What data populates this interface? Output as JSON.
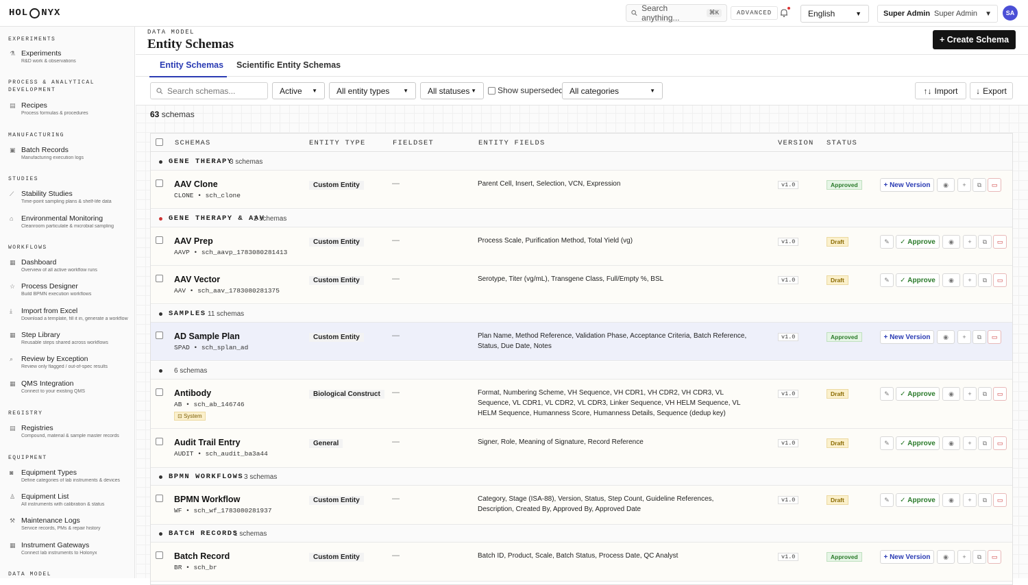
{
  "topbar": {
    "logo_left": "HOL",
    "logo_right": "NYX",
    "search_placeholder": "Search anything...",
    "search_shortcut": "⌘K",
    "advanced_label": "ADVANCED",
    "language": "English",
    "user_role": "Super Admin",
    "user_select": "Super Admin",
    "avatar_initials": "SA"
  },
  "sidebar": {
    "sections": [
      {
        "title": "EXPERIMENTS"
      },
      {
        "title": "PROCESS & ANALYTICAL DEVELOPMENT"
      },
      {
        "title": "MANUFACTURING"
      },
      {
        "title": "STUDIES"
      },
      {
        "title": "WORKFLOWS"
      },
      {
        "title": "REGISTRY"
      },
      {
        "title": "EQUIPMENT"
      },
      {
        "title": "DATA MODEL"
      }
    ],
    "items": [
      {
        "label": "Experiments",
        "desc": "R&D work & observations",
        "icon": "flask-icon"
      },
      {
        "label": "Recipes",
        "desc": "Process formulas & procedures",
        "icon": "document-icon"
      },
      {
        "label": "Batch Records",
        "desc": "Manufacturing execution logs",
        "icon": "clipboard-icon"
      },
      {
        "label": "Stability Studies",
        "desc": "Time-point sampling plans & shelf-life data",
        "icon": "chart-line-icon"
      },
      {
        "label": "Environmental Monitoring",
        "desc": "Cleanroom particulate & microbial sampling",
        "icon": "house-icon"
      },
      {
        "label": "Dashboard",
        "desc": "Overview of all active workflow runs",
        "icon": "grid-icon"
      },
      {
        "label": "Process Designer",
        "desc": "Build BPMN execution workflows",
        "icon": "star-icon"
      },
      {
        "label": "Import from Excel",
        "desc": "Download a template, fill it in, generate a workflow",
        "icon": "download-icon"
      },
      {
        "label": "Step Library",
        "desc": "Reusable steps shared across workflows",
        "icon": "grid-icon"
      },
      {
        "label": "Review by Exception",
        "desc": "Review only flagged / out-of-spec results",
        "icon": "search-icon"
      },
      {
        "label": "QMS Integration",
        "desc": "Connect to your existing QMS",
        "icon": "grid-icon"
      },
      {
        "label": "Registries",
        "desc": "Compound, material & sample master records",
        "icon": "database-icon"
      },
      {
        "label": "Equipment Types",
        "desc": "Define categories of lab instruments & devices",
        "icon": "camera-icon"
      },
      {
        "label": "Equipment List",
        "desc": "All instruments with calibration & status",
        "icon": "person-icon"
      },
      {
        "label": "Maintenance Logs",
        "desc": "Service records, PMs & repair history",
        "icon": "wrench-icon"
      },
      {
        "label": "Instrument Gateways",
        "desc": "Connect lab instruments to Holonyx",
        "icon": "grid-icon"
      }
    ]
  },
  "header": {
    "breadcrumb": "DATA MODEL",
    "title": "Entity Schemas",
    "create_button": "+ Create Schema"
  },
  "tabs": [
    {
      "label": "Entity Schemas",
      "active": true
    },
    {
      "label": "Scientific Entity Schemas",
      "active": false
    }
  ],
  "filters": {
    "search_placeholder": "Search schemas...",
    "state": "Active",
    "entity_types": "All entity types",
    "statuses": "All statuses",
    "show_superseded": "Show superseded",
    "categories": "All categories",
    "import_label": "Import",
    "export_label": "Export"
  },
  "count": {
    "number": "63",
    "label": "schemas"
  },
  "table": {
    "headers": [
      "SCHEMAS",
      "ENTITY TYPE",
      "FIELDSET",
      "ENTITY FIELDS",
      "VERSION",
      "STATUS"
    ],
    "groups": [
      {
        "name": "GENE THERAPY",
        "count": "3 schemas"
      },
      {
        "name": "GENE THERAPY & AAV",
        "count": "2 schemas"
      },
      {
        "name": "SAMPLES",
        "count": "11 schemas"
      },
      {
        "name": "",
        "count": "6 schemas"
      },
      {
        "name": "BPMN WORKFLOWS",
        "count": "3 schemas"
      },
      {
        "name": "BATCH RECORDS",
        "count": "1 schemas"
      }
    ],
    "rows": [
      {
        "name": "AAV Clone",
        "code": "CLONE  •  sch_clone",
        "type": "Custom Entity",
        "fieldset": "—",
        "fields": "Parent Cell, Insert, Selection, VCN, Expression",
        "version": "v1.0",
        "status": "Approved"
      },
      {
        "name": "AAV Prep",
        "code": "AAVP  •  sch_aavp_1783080281413",
        "type": "Custom Entity",
        "fieldset": "—",
        "fields": "Process Scale, Purification Method, Total Yield (vg)",
        "version": "v1.0",
        "status": "Draft"
      },
      {
        "name": "AAV Vector",
        "code": "AAV  •  sch_aav_1783080281375",
        "type": "Custom Entity",
        "fieldset": "—",
        "fields": "Serotype, Titer (vg/mL), Transgene Class, Full/Empty %, BSL",
        "version": "v1.0",
        "status": "Draft"
      },
      {
        "name": "AD Sample Plan",
        "code": "SPAD  •  sch_splan_ad",
        "type": "Custom Entity",
        "fieldset": "—",
        "fields": "Plan Name, Method Reference, Validation Phase, Acceptance Criteria, Batch Reference, Status, Due Date, Notes",
        "version": "v1.0",
        "status": "Approved"
      },
      {
        "name": "Antibody",
        "code": "AB  •  sch_ab_146746",
        "type": "Biological Construct",
        "fieldset": "—",
        "fields": "Format, Numbering Scheme, VH Sequence, VH CDR1, VH CDR2, VH CDR3, VL Sequence, VL CDR1, VL CDR2, VL CDR3, Linker Sequence, VH HELM Sequence, VL HELM Sequence, Humanness Score, Humanness Details, Sequence (dedup key)",
        "version": "v1.0",
        "status": "Draft",
        "badge": "System"
      },
      {
        "name": "Audit Trail Entry",
        "code": "AUDIT  •  sch_audit_ba3a44",
        "type": "General",
        "fieldset": "—",
        "fields": "Signer, Role, Meaning of Signature, Record Reference",
        "version": "v1.0",
        "status": "Draft"
      },
      {
        "name": "BPMN Workflow",
        "code": "WF  •  sch_wf_1783080281937",
        "type": "Custom Entity",
        "fieldset": "—",
        "fields": "Category, Stage (ISA-88), Version, Status, Step Count, Guideline References, Description, Created By, Approved By, Approved Date",
        "version": "v1.0",
        "status": "Draft"
      },
      {
        "name": "Batch Record",
        "code": "BR  •  sch_br",
        "type": "Custom Entity",
        "fieldset": "—",
        "fields": "Batch ID, Product, Scale, Batch Status, Process Date, QC Analyst",
        "version": "v1.0",
        "status": "Approved"
      }
    ],
    "new_version_label": "+ New Version",
    "approve_label": "Approve"
  }
}
